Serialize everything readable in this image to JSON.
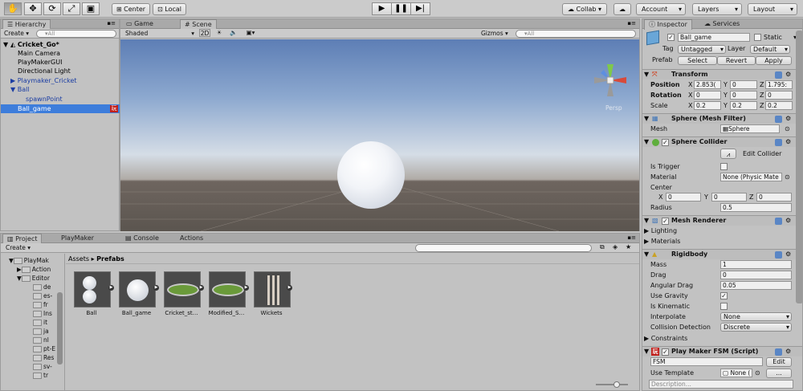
{
  "toolbar": {
    "tools": [
      "hand-tool",
      "move-tool",
      "rotate-tool",
      "scale-tool",
      "rect-tool"
    ],
    "pivot_center": "Center",
    "pivot_local": "Local",
    "collab": "Collab ▾",
    "account": "Account",
    "layers": "Layers",
    "layout": "Layout"
  },
  "hierarchy": {
    "tab": "Hierarchy",
    "create": "Create ▾",
    "search_placeholder": "▾All",
    "scene": "Cricket_Go*",
    "items": [
      "Main Camera",
      "PlayMakerGUI",
      "Directional Light",
      "Playmaker_Cricket",
      "Ball",
      "spawnPoint",
      "Ball_game"
    ],
    "badge": "玩"
  },
  "scene_view": {
    "tab_game": "Game",
    "tab_scene": "Scene",
    "shading": "Shaded",
    "mode_2d": "2D",
    "gizmos": "Gizmos ▾",
    "search_placeholder": "▾All",
    "persp": "Persp"
  },
  "project": {
    "tabs": [
      "Project",
      "PlayMaker",
      "Console",
      "Actions"
    ],
    "create": "Create ▾",
    "breadcrumb_root": "Assets",
    "breadcrumb_sep": "▸",
    "breadcrumb_current": "Prefabs",
    "tree": [
      "PlayMak",
      "Action",
      "Editor",
      "de",
      "es-",
      "fr",
      "Ins",
      "it",
      "ja",
      "nl",
      "pt-E",
      "Res",
      "sv-",
      "tr"
    ],
    "assets": [
      "Ball",
      "Ball_game",
      "Cricket_st…",
      "Modified_S…",
      "Wickets"
    ]
  },
  "inspector": {
    "tab": "Inspector",
    "tab_services": "Services",
    "name": "Ball_game",
    "static": "Static",
    "tag_label": "Tag",
    "tag": "Untagged",
    "layer_label": "Layer",
    "layer": "Default",
    "prefab_label": "Prefab",
    "prefab_select": "Select",
    "prefab_revert": "Revert",
    "prefab_apply": "Apply",
    "transform": {
      "title": "Transform",
      "position_label": "Position",
      "rotation_label": "Rotation",
      "scale_label": "Scale",
      "axis_x": "X",
      "axis_y": "Y",
      "axis_z": "Z",
      "position": [
        "2.853(",
        "0",
        "1.795:"
      ],
      "rotation": [
        "0",
        "0",
        "0"
      ],
      "scale": [
        "0.2",
        "0.2",
        "0.2"
      ]
    },
    "mesh_filter": {
      "title": "Sphere (Mesh Filter)",
      "mesh_label": "Mesh",
      "mesh": "Sphere"
    },
    "sphere_collider": {
      "title": "Sphere Collider",
      "edit_collider": "Edit Collider",
      "is_trigger": "Is Trigger",
      "material_label": "Material",
      "material": "None (Physic Mate",
      "center_label": "Center",
      "center": [
        "0",
        "0",
        "0"
      ],
      "radius_label": "Radius",
      "radius": "0.5"
    },
    "mesh_renderer": {
      "title": "Mesh Renderer",
      "lighting": "Lighting",
      "materials": "Materials"
    },
    "rigidbody": {
      "title": "Rigidbody",
      "mass_label": "Mass",
      "mass": "1",
      "drag_label": "Drag",
      "drag": "0",
      "angular_drag_label": "Angular Drag",
      "angular_drag": "0.05",
      "use_gravity": "Use Gravity",
      "is_kinematic": "Is Kinematic",
      "interpolate_label": "Interpolate",
      "interpolate": "None",
      "collision_label": "Collision Detection",
      "collision": "Discrete",
      "constraints": "Constraints"
    },
    "fsm": {
      "title": "Play Maker FSM (Script)",
      "fsm_name": "FSM",
      "edit": "Edit",
      "use_template": "Use Template",
      "template": "None (",
      "ellipsis": "...",
      "description_placeholder": "Description..."
    }
  }
}
